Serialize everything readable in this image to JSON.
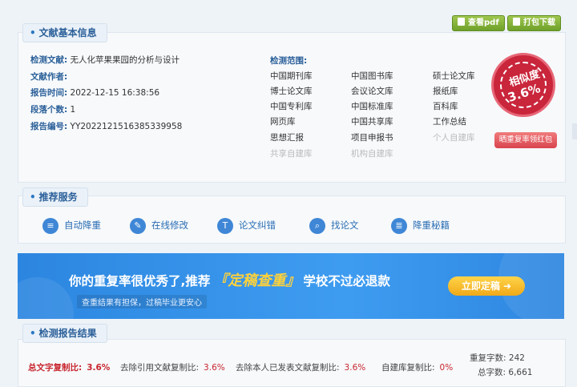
{
  "header": {
    "buttons": [
      {
        "label": "查看pdf"
      },
      {
        "label": "打包下载"
      }
    ]
  },
  "basic_info": {
    "title": "文献基本信息",
    "rows": [
      {
        "label": "检测文献:",
        "value": "无人化苹果果园的分析与设计"
      },
      {
        "label": "文献作者:",
        "value": ""
      },
      {
        "label": "报告时间:",
        "value": "2022-12-15 16:38:56"
      },
      {
        "label": "段落个数:",
        "value": "1"
      },
      {
        "label": "报告编号:",
        "value": "YY2022121516385339958"
      }
    ],
    "scope_label": "检测范围:",
    "scope": [
      [
        "中国期刊库",
        "中国图书库",
        "硕士论文库"
      ],
      [
        "博士论文库",
        "会议论文库",
        "报纸库"
      ],
      [
        "中国专利库",
        "中国标准库",
        "百科库"
      ],
      [
        "网页库",
        "中国共享库",
        "工作总结"
      ],
      [
        "思想汇报",
        "项目申报书",
        "个人自建库"
      ],
      [
        "共享自建库",
        "机构自建库",
        ""
      ]
    ],
    "stamp": {
      "label": "相似度",
      "value": "3.6%"
    },
    "redpack_label": "晒重复率领红包"
  },
  "services": {
    "title": "推荐服务",
    "items": [
      {
        "label": "自动降重",
        "icon": "auto-reduce-icon"
      },
      {
        "label": "在线修改",
        "icon": "pencil-icon"
      },
      {
        "label": "论文纠错",
        "icon": "text-icon"
      },
      {
        "label": "找论文",
        "icon": "search-icon"
      },
      {
        "label": "降重秘籍",
        "icon": "book-icon"
      }
    ]
  },
  "banner": {
    "text_before": "你的重复率很优秀了,推荐",
    "highlight": "『定稿查重』",
    "text_after": "学校不过必退款",
    "sub": "查重结果有担保，过稿毕业更安心",
    "cta": "立即定稿 ➜"
  },
  "results": {
    "title": "检测报告结果",
    "items": [
      {
        "label": "总文字复制比:",
        "value": "3.6%"
      },
      {
        "label": "去除引用文献复制比:",
        "value": "3.6%"
      },
      {
        "label": "去除本人已发表文献复制比:",
        "value": "3.6%"
      },
      {
        "label": "自建库复制比:",
        "value": "0%"
      }
    ],
    "dup_chars_label": "重复字数:",
    "dup_chars_value": "242",
    "total_chars_label": "总字数:",
    "total_chars_value": "6,661"
  },
  "colors": {
    "accent": "#2a5f99",
    "red": "#c8262e",
    "banner": "#3e9cf0"
  }
}
